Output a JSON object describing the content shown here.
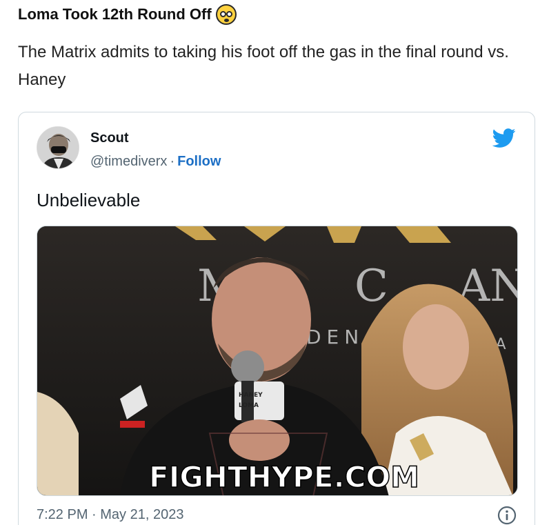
{
  "post": {
    "title": "Loma Took 12th Round Off",
    "title_emoji": "flushed-face-emoji",
    "body": "The Matrix admits to taking his foot off the gas in the final round vs. Haney"
  },
  "tweet": {
    "author_name": "Scout",
    "handle": "@timediverx",
    "separator": "·",
    "follow_label": "Follow",
    "text": "Unbelievable",
    "timestamp": "7:22 PM · May 21, 2023",
    "brand_icon": "twitter-bird-icon",
    "info_icon": "info-icon",
    "accent_color": "#1d9bf0",
    "link_color": "#1d6fc5"
  },
  "media": {
    "watermark": "FIGHTHYPE.COM",
    "mic_flag_lines": [
      "HANEY",
      "LOMA"
    ],
    "backdrop_letters": [
      "M",
      "C",
      "AN",
      "DEN",
      "NA"
    ]
  }
}
